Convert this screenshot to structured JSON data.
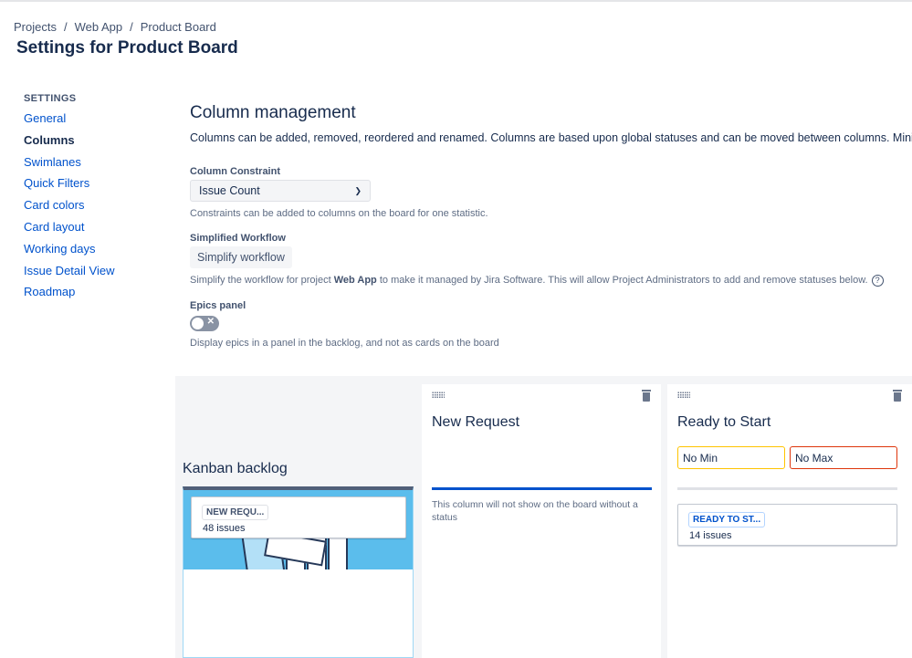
{
  "breadcrumb": [
    "Projects",
    "Web App",
    "Product Board"
  ],
  "page_title": "Settings for Product Board",
  "sidebar": {
    "heading": "SETTINGS",
    "items": [
      {
        "label": "General"
      },
      {
        "label": "Columns",
        "active": true
      },
      {
        "label": "Swimlanes"
      },
      {
        "label": "Quick Filters"
      },
      {
        "label": "Card colors"
      },
      {
        "label": "Card layout"
      },
      {
        "label": "Working days"
      },
      {
        "label": "Issue Detail View"
      },
      {
        "label": "Roadmap"
      }
    ]
  },
  "main": {
    "heading": "Column management",
    "description": "Columns can be added, removed, reordered and renamed. Columns are based upon global statuses and can be moved between columns. Minimum and ma",
    "constraint": {
      "label": "Column Constraint",
      "value": "Issue Count",
      "help": "Constraints can be added to columns on the board for one statistic."
    },
    "workflow": {
      "label": "Simplified Workflow",
      "button": "Simplify workflow",
      "help_pre": "Simplify the workflow for project ",
      "help_project": "Web App",
      "help_post": " to make it managed by Jira Software. This will allow Project Administrators to add and remove statuses below.",
      "help_icon": "?"
    },
    "epics": {
      "label": "Epics panel",
      "enabled": false,
      "help": "Display epics in a panel in the backlog, and not as cards on the board"
    }
  },
  "board": {
    "backlog": {
      "title": "Kanban backlog",
      "status": "NEW REQU...",
      "count": "48 issues"
    },
    "columns": [
      {
        "title": "New Request",
        "note": "This column will not show on the board without a status"
      },
      {
        "title": "Ready to Start",
        "min": "No Min",
        "max": "No Max",
        "status": "READY TO ST...",
        "count": "14 issues"
      }
    ]
  },
  "colors": {
    "link": "#0052cc",
    "text": "#172b4d",
    "illustration": "#5bbdec",
    "min_border": "#ffc400",
    "max_border": "#de350b"
  }
}
